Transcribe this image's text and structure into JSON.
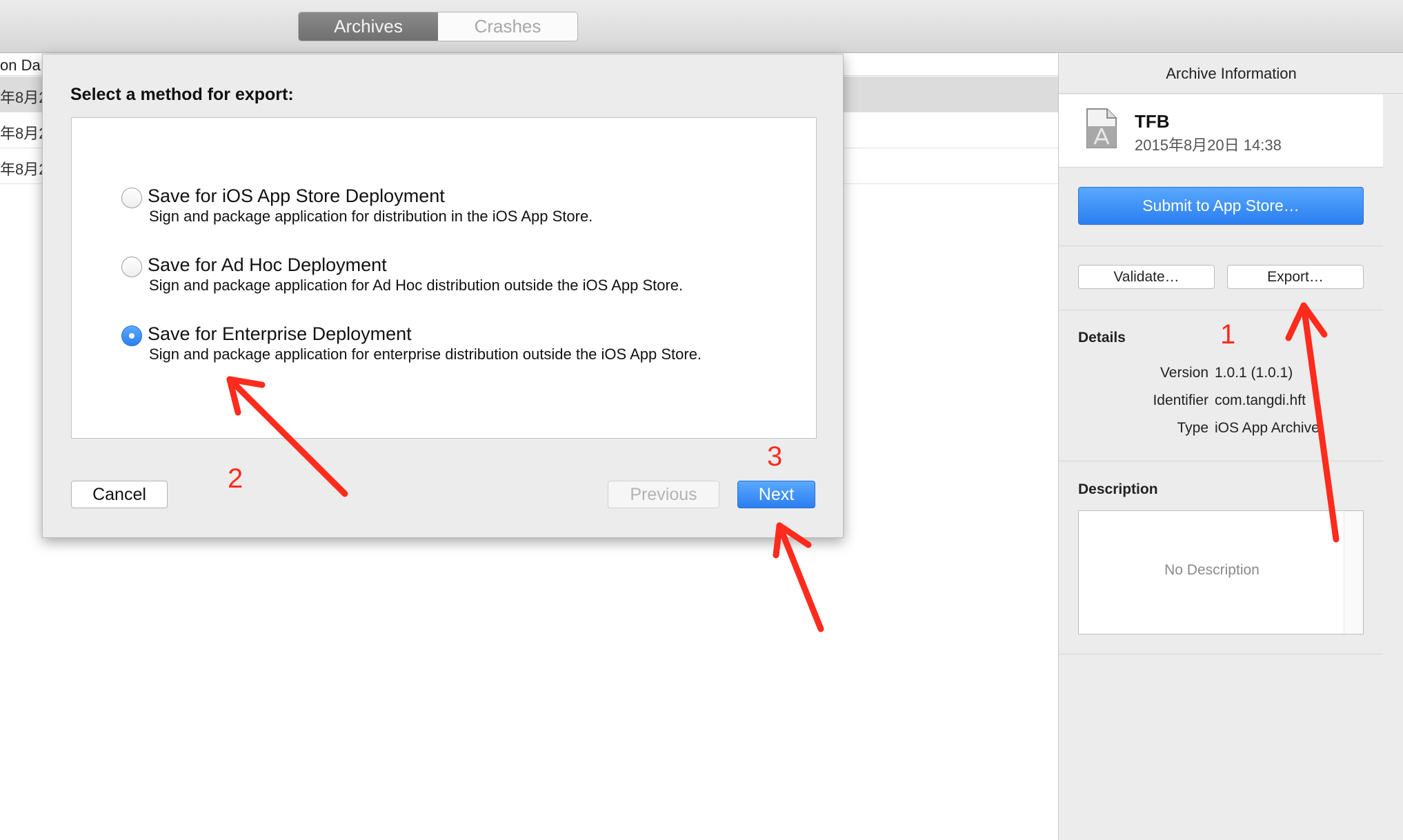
{
  "toolbar": {
    "tabs": [
      {
        "label": "Archives",
        "active": true
      },
      {
        "label": "Crashes",
        "active": false
      }
    ]
  },
  "list": {
    "header": "on Da",
    "rows": [
      "年8月2",
      "年8月2",
      "年8月2"
    ]
  },
  "inspector": {
    "title": "Archive Information",
    "app_name": "TFB",
    "app_date": "2015年8月20日 14:38",
    "app_icon": "app-archive-icon",
    "submit_label": "Submit to App Store…",
    "validate_label": "Validate…",
    "export_label": "Export…",
    "details_title": "Details",
    "details": [
      {
        "key": "Version",
        "value": "1.0.1 (1.0.1)"
      },
      {
        "key": "Identifier",
        "value": "com.tangdi.hft"
      },
      {
        "key": "Type",
        "value": "iOS App Archive"
      }
    ],
    "description_title": "Description",
    "description_placeholder": "No Description"
  },
  "sheet": {
    "title": "Select a method for export:",
    "options": [
      {
        "title": "Save for iOS App Store Deployment",
        "desc": "Sign and package application for distribution in the iOS App Store.",
        "selected": false
      },
      {
        "title": "Save for Ad Hoc Deployment",
        "desc": "Sign and package application for Ad Hoc distribution outside the iOS App Store.",
        "selected": false
      },
      {
        "title": "Save for Enterprise Deployment",
        "desc": "Sign and package application for enterprise distribution outside the iOS App Store.",
        "selected": true
      }
    ],
    "cancel_label": "Cancel",
    "previous_label": "Previous",
    "next_label": "Next"
  },
  "annotations": {
    "color": "#ff2b1c",
    "step1": "1",
    "step2": "2",
    "step3": "3"
  },
  "colors": {
    "accent_blue": "#2b7ef0",
    "segment_active": "#7c7c7c",
    "inspector_bg": "#ececec"
  }
}
